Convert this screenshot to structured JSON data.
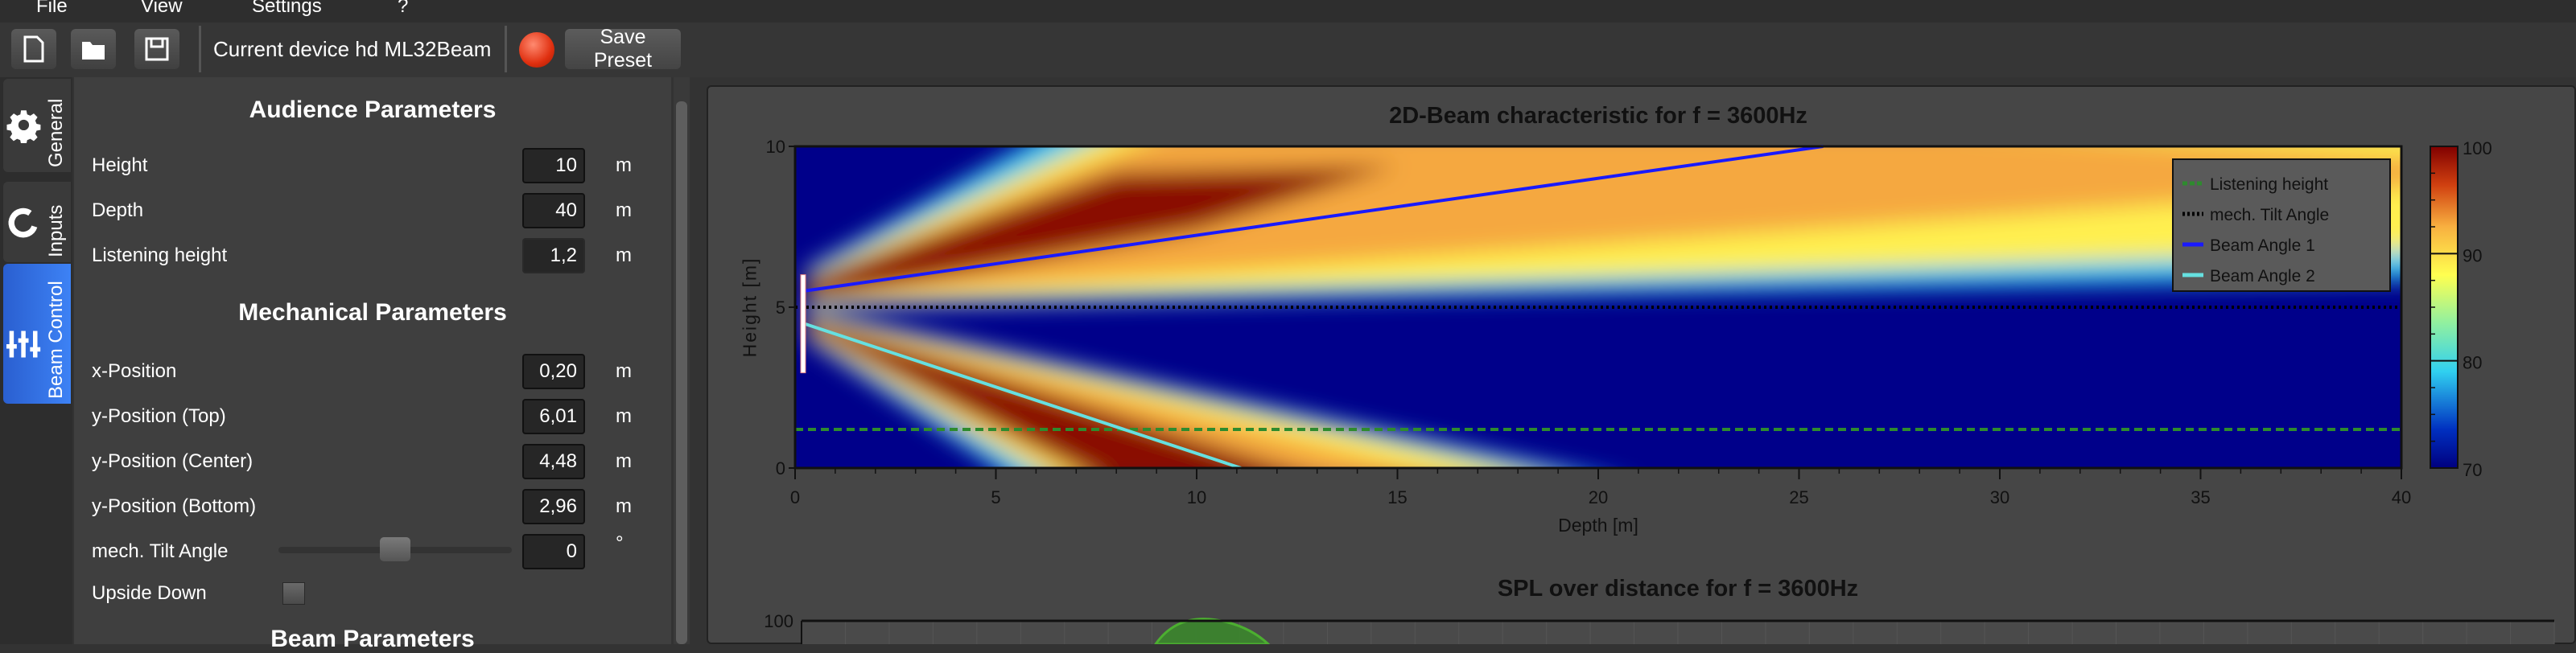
{
  "menu": [
    "File",
    "View",
    "Settings",
    "?"
  ],
  "toolbar": {
    "new_icon": "new-file-icon",
    "open_icon": "folder-open-icon",
    "save_icon": "floppy-save-icon",
    "device_label": "Current device  hd ML32Beam",
    "record_indicator_color": "#e03010",
    "save_preset": "Save Preset"
  },
  "tabs": [
    {
      "label": "General",
      "icon": "gear-icon"
    },
    {
      "label": "Inputs",
      "icon": "refresh-icon"
    },
    {
      "label": "Beam Control",
      "icon": "sliders-icon",
      "active": true
    }
  ],
  "panel": {
    "audience_heading": "Audience Parameters",
    "audience": [
      {
        "label": "Height",
        "value": "10",
        "unit": "m"
      },
      {
        "label": "Depth",
        "value": "40",
        "unit": "m"
      },
      {
        "label": "Listening height",
        "value": "1,2",
        "unit": "m"
      }
    ],
    "mech_heading": "Mechanical Parameters",
    "mech": [
      {
        "label": "x-Position",
        "value": "0,20",
        "unit": "m"
      },
      {
        "label": "y-Position (Top)",
        "value": "6,01",
        "unit": "m"
      },
      {
        "label": "y-Position (Center)",
        "value": "4,48",
        "unit": "m"
      },
      {
        "label": "y-Position (Bottom)",
        "value": "2,96",
        "unit": "m"
      }
    ],
    "tilt": {
      "label": "mech. Tilt Angle",
      "value": "0",
      "unit": "°",
      "slider_fraction": 0.5
    },
    "upside": {
      "label": "Upside Down",
      "checked": false
    },
    "beam_heading": "Beam Parameters"
  },
  "chart_data": [
    {
      "type": "heatmap",
      "title": "2D-Beam characteristic for f = 3600Hz",
      "xlabel": "Depth [m]",
      "ylabel": "Height [m]",
      "xlim": [
        0,
        40
      ],
      "ylim": [
        0,
        10
      ],
      "xticks": [
        0,
        5,
        10,
        15,
        20,
        25,
        30,
        35,
        40
      ],
      "yticks": [
        0,
        5,
        10
      ],
      "colorbar": {
        "range": [
          70,
          100
        ],
        "ticks": [
          70,
          80,
          90,
          100
        ],
        "colormap": "jet"
      },
      "legend": {
        "placement": "top-right",
        "entries": [
          {
            "name": "Listening height",
            "color": "#2e8b2e",
            "style": "dashed"
          },
          {
            "name": "mech. Tilt Angle",
            "color": "#000000",
            "style": "dotted"
          },
          {
            "name": "Beam Angle 1",
            "color": "#1a1aff",
            "style": "solid"
          },
          {
            "name": "Beam Angle 2",
            "color": "#66e0e0",
            "style": "solid"
          }
        ]
      },
      "lines": {
        "listening_height": 1.2,
        "tilt_y": 5,
        "beam1": [
          [
            0.2,
            5.5
          ],
          [
            25.6,
            10
          ]
        ],
        "beam2": [
          [
            0.2,
            4.5
          ],
          [
            11.1,
            0
          ]
        ],
        "speaker": {
          "x": 0.2,
          "y_top": 6.01,
          "y_bottom": 2.96
        }
      }
    },
    {
      "type": "area",
      "title": "SPL over distance for f = 3600Hz",
      "ylim_top": 100,
      "yticks": [
        100
      ]
    }
  ]
}
